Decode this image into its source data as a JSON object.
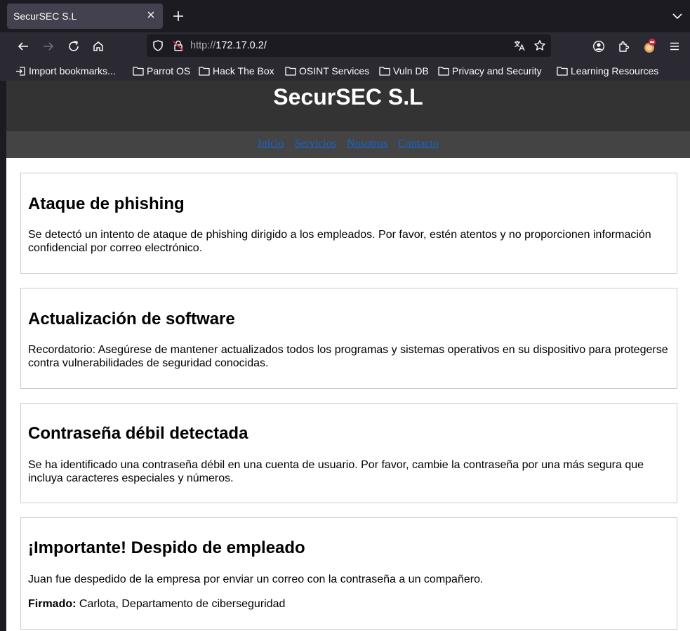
{
  "browser": {
    "tab_title": "SecurSEC S.L",
    "url_scheme": "http://",
    "url_host": "172.17.0.2/",
    "bookmarks": [
      "Import bookmarks...",
      "Parrot OS",
      "Hack The Box",
      "OSINT Services",
      "Vuln DB",
      "Privacy and Security",
      "Learning Resources"
    ]
  },
  "site": {
    "title": "SecurSEC S.L",
    "nav": [
      "Inicio",
      "Servicios",
      "Nosotros",
      "Contacto"
    ]
  },
  "posts": [
    {
      "title": "Ataque de phishing",
      "body": "Se detectó un intento de ataque de phishing dirigido a los empleados. Por favor, estén atentos y no proporcionen información confidencial por correo electrónico."
    },
    {
      "title": "Actualización de software",
      "body": "Recordatorio: Asegúrese de mantener actualizados todos los programas y sistemas operativos en su dispositivo para protegerse contra vulnerabilidades de seguridad conocidas."
    },
    {
      "title": "Contraseña débil detectada",
      "body": "Se ha identificado una contraseña débil en una cuenta de usuario. Por favor, cambie la contraseña por una más segura que incluya caracteres especiales y números."
    },
    {
      "title": "¡Importante! Despido de empleado",
      "body": "Juan fue despedido de la empresa por enviar un correo con la contraseña a un compañero.",
      "signature_label": "Firmado:",
      "signature_text": " Carlota, Departamento de ciberseguridad"
    }
  ]
}
